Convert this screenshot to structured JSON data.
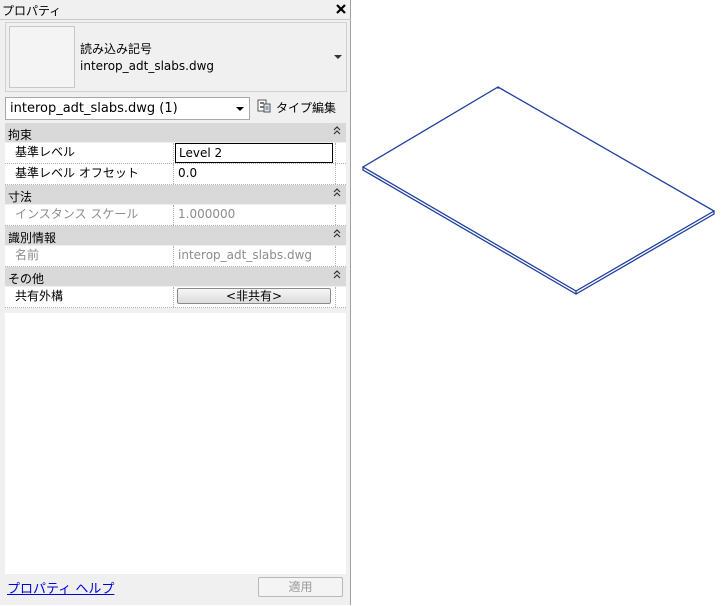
{
  "panel": {
    "title": "プロパティ",
    "close_glyph": "✕"
  },
  "preview": {
    "line1": "読み込み記号",
    "line2": "interop_adt_slabs.dwg"
  },
  "selector": {
    "value": "interop_adt_slabs.dwg (1)"
  },
  "type_edit": {
    "label": "タイプ編集"
  },
  "groups": [
    {
      "name": "拘束",
      "rows": [
        {
          "name": "基準レベル",
          "value": "Level 2"
        },
        {
          "name": "基準レベル オフセット",
          "value": "0.0"
        }
      ]
    },
    {
      "name": "寸法",
      "rows": [
        {
          "name": "インスタンス スケール",
          "value": "1.000000"
        }
      ]
    },
    {
      "name": "識別情報",
      "rows": [
        {
          "name": "名前",
          "value": "interop_adt_slabs.dwg"
        }
      ]
    },
    {
      "name": "その他",
      "rows": [
        {
          "name": "共有外構",
          "value": "<非共有>"
        }
      ]
    }
  ],
  "collapse_glyph": "≈",
  "footer": {
    "help_link": "プロパティ ヘルプ",
    "apply": "適用"
  },
  "colors": {
    "outline": "#1f3f9f",
    "link": "#0000d8"
  }
}
